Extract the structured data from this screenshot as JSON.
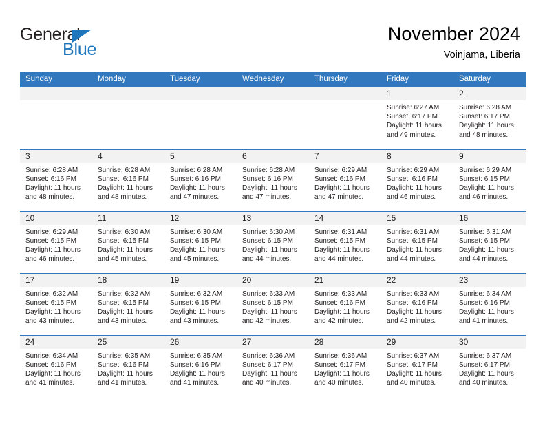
{
  "brand": {
    "name_part1": "General",
    "name_part2": "Blue",
    "triangle_icon": "blue-triangle-logo-mark",
    "accent_color": "#1e76bd"
  },
  "header": {
    "title": "November 2024",
    "subtitle": "Voinjama, Liberia"
  },
  "theme": {
    "header_blue": "#3178be",
    "daynum_band": "#f2f2f2",
    "text": "#231f20"
  },
  "labels": {
    "sunrise_prefix": "Sunrise:",
    "sunset_prefix": "Sunset:",
    "daylight_prefix": "Daylight:"
  },
  "weekdays": [
    "Sunday",
    "Monday",
    "Tuesday",
    "Wednesday",
    "Thursday",
    "Friday",
    "Saturday"
  ],
  "weeks": [
    [
      {
        "day": "",
        "sunrise": "",
        "sunset": "",
        "daylight_line1": "",
        "daylight_line2": ""
      },
      {
        "day": "",
        "sunrise": "",
        "sunset": "",
        "daylight_line1": "",
        "daylight_line2": ""
      },
      {
        "day": "",
        "sunrise": "",
        "sunset": "",
        "daylight_line1": "",
        "daylight_line2": ""
      },
      {
        "day": "",
        "sunrise": "",
        "sunset": "",
        "daylight_line1": "",
        "daylight_line2": ""
      },
      {
        "day": "",
        "sunrise": "",
        "sunset": "",
        "daylight_line1": "",
        "daylight_line2": ""
      },
      {
        "day": "1",
        "sunrise": "Sunrise: 6:27 AM",
        "sunset": "Sunset: 6:17 PM",
        "daylight_line1": "Daylight: 11 hours",
        "daylight_line2": "and 49 minutes."
      },
      {
        "day": "2",
        "sunrise": "Sunrise: 6:28 AM",
        "sunset": "Sunset: 6:17 PM",
        "daylight_line1": "Daylight: 11 hours",
        "daylight_line2": "and 48 minutes."
      }
    ],
    [
      {
        "day": "3",
        "sunrise": "Sunrise: 6:28 AM",
        "sunset": "Sunset: 6:16 PM",
        "daylight_line1": "Daylight: 11 hours",
        "daylight_line2": "and 48 minutes."
      },
      {
        "day": "4",
        "sunrise": "Sunrise: 6:28 AM",
        "sunset": "Sunset: 6:16 PM",
        "daylight_line1": "Daylight: 11 hours",
        "daylight_line2": "and 48 minutes."
      },
      {
        "day": "5",
        "sunrise": "Sunrise: 6:28 AM",
        "sunset": "Sunset: 6:16 PM",
        "daylight_line1": "Daylight: 11 hours",
        "daylight_line2": "and 47 minutes."
      },
      {
        "day": "6",
        "sunrise": "Sunrise: 6:28 AM",
        "sunset": "Sunset: 6:16 PM",
        "daylight_line1": "Daylight: 11 hours",
        "daylight_line2": "and 47 minutes."
      },
      {
        "day": "7",
        "sunrise": "Sunrise: 6:29 AM",
        "sunset": "Sunset: 6:16 PM",
        "daylight_line1": "Daylight: 11 hours",
        "daylight_line2": "and 47 minutes."
      },
      {
        "day": "8",
        "sunrise": "Sunrise: 6:29 AM",
        "sunset": "Sunset: 6:16 PM",
        "daylight_line1": "Daylight: 11 hours",
        "daylight_line2": "and 46 minutes."
      },
      {
        "day": "9",
        "sunrise": "Sunrise: 6:29 AM",
        "sunset": "Sunset: 6:15 PM",
        "daylight_line1": "Daylight: 11 hours",
        "daylight_line2": "and 46 minutes."
      }
    ],
    [
      {
        "day": "10",
        "sunrise": "Sunrise: 6:29 AM",
        "sunset": "Sunset: 6:15 PM",
        "daylight_line1": "Daylight: 11 hours",
        "daylight_line2": "and 46 minutes."
      },
      {
        "day": "11",
        "sunrise": "Sunrise: 6:30 AM",
        "sunset": "Sunset: 6:15 PM",
        "daylight_line1": "Daylight: 11 hours",
        "daylight_line2": "and 45 minutes."
      },
      {
        "day": "12",
        "sunrise": "Sunrise: 6:30 AM",
        "sunset": "Sunset: 6:15 PM",
        "daylight_line1": "Daylight: 11 hours",
        "daylight_line2": "and 45 minutes."
      },
      {
        "day": "13",
        "sunrise": "Sunrise: 6:30 AM",
        "sunset": "Sunset: 6:15 PM",
        "daylight_line1": "Daylight: 11 hours",
        "daylight_line2": "and 44 minutes."
      },
      {
        "day": "14",
        "sunrise": "Sunrise: 6:31 AM",
        "sunset": "Sunset: 6:15 PM",
        "daylight_line1": "Daylight: 11 hours",
        "daylight_line2": "and 44 minutes."
      },
      {
        "day": "15",
        "sunrise": "Sunrise: 6:31 AM",
        "sunset": "Sunset: 6:15 PM",
        "daylight_line1": "Daylight: 11 hours",
        "daylight_line2": "and 44 minutes."
      },
      {
        "day": "16",
        "sunrise": "Sunrise: 6:31 AM",
        "sunset": "Sunset: 6:15 PM",
        "daylight_line1": "Daylight: 11 hours",
        "daylight_line2": "and 44 minutes."
      }
    ],
    [
      {
        "day": "17",
        "sunrise": "Sunrise: 6:32 AM",
        "sunset": "Sunset: 6:15 PM",
        "daylight_line1": "Daylight: 11 hours",
        "daylight_line2": "and 43 minutes."
      },
      {
        "day": "18",
        "sunrise": "Sunrise: 6:32 AM",
        "sunset": "Sunset: 6:15 PM",
        "daylight_line1": "Daylight: 11 hours",
        "daylight_line2": "and 43 minutes."
      },
      {
        "day": "19",
        "sunrise": "Sunrise: 6:32 AM",
        "sunset": "Sunset: 6:15 PM",
        "daylight_line1": "Daylight: 11 hours",
        "daylight_line2": "and 43 minutes."
      },
      {
        "day": "20",
        "sunrise": "Sunrise: 6:33 AM",
        "sunset": "Sunset: 6:15 PM",
        "daylight_line1": "Daylight: 11 hours",
        "daylight_line2": "and 42 minutes."
      },
      {
        "day": "21",
        "sunrise": "Sunrise: 6:33 AM",
        "sunset": "Sunset: 6:16 PM",
        "daylight_line1": "Daylight: 11 hours",
        "daylight_line2": "and 42 minutes."
      },
      {
        "day": "22",
        "sunrise": "Sunrise: 6:33 AM",
        "sunset": "Sunset: 6:16 PM",
        "daylight_line1": "Daylight: 11 hours",
        "daylight_line2": "and 42 minutes."
      },
      {
        "day": "23",
        "sunrise": "Sunrise: 6:34 AM",
        "sunset": "Sunset: 6:16 PM",
        "daylight_line1": "Daylight: 11 hours",
        "daylight_line2": "and 41 minutes."
      }
    ],
    [
      {
        "day": "24",
        "sunrise": "Sunrise: 6:34 AM",
        "sunset": "Sunset: 6:16 PM",
        "daylight_line1": "Daylight: 11 hours",
        "daylight_line2": "and 41 minutes."
      },
      {
        "day": "25",
        "sunrise": "Sunrise: 6:35 AM",
        "sunset": "Sunset: 6:16 PM",
        "daylight_line1": "Daylight: 11 hours",
        "daylight_line2": "and 41 minutes."
      },
      {
        "day": "26",
        "sunrise": "Sunrise: 6:35 AM",
        "sunset": "Sunset: 6:16 PM",
        "daylight_line1": "Daylight: 11 hours",
        "daylight_line2": "and 41 minutes."
      },
      {
        "day": "27",
        "sunrise": "Sunrise: 6:36 AM",
        "sunset": "Sunset: 6:17 PM",
        "daylight_line1": "Daylight: 11 hours",
        "daylight_line2": "and 40 minutes."
      },
      {
        "day": "28",
        "sunrise": "Sunrise: 6:36 AM",
        "sunset": "Sunset: 6:17 PM",
        "daylight_line1": "Daylight: 11 hours",
        "daylight_line2": "and 40 minutes."
      },
      {
        "day": "29",
        "sunrise": "Sunrise: 6:37 AM",
        "sunset": "Sunset: 6:17 PM",
        "daylight_line1": "Daylight: 11 hours",
        "daylight_line2": "and 40 minutes."
      },
      {
        "day": "30",
        "sunrise": "Sunrise: 6:37 AM",
        "sunset": "Sunset: 6:17 PM",
        "daylight_line1": "Daylight: 11 hours",
        "daylight_line2": "and 40 minutes."
      }
    ]
  ]
}
